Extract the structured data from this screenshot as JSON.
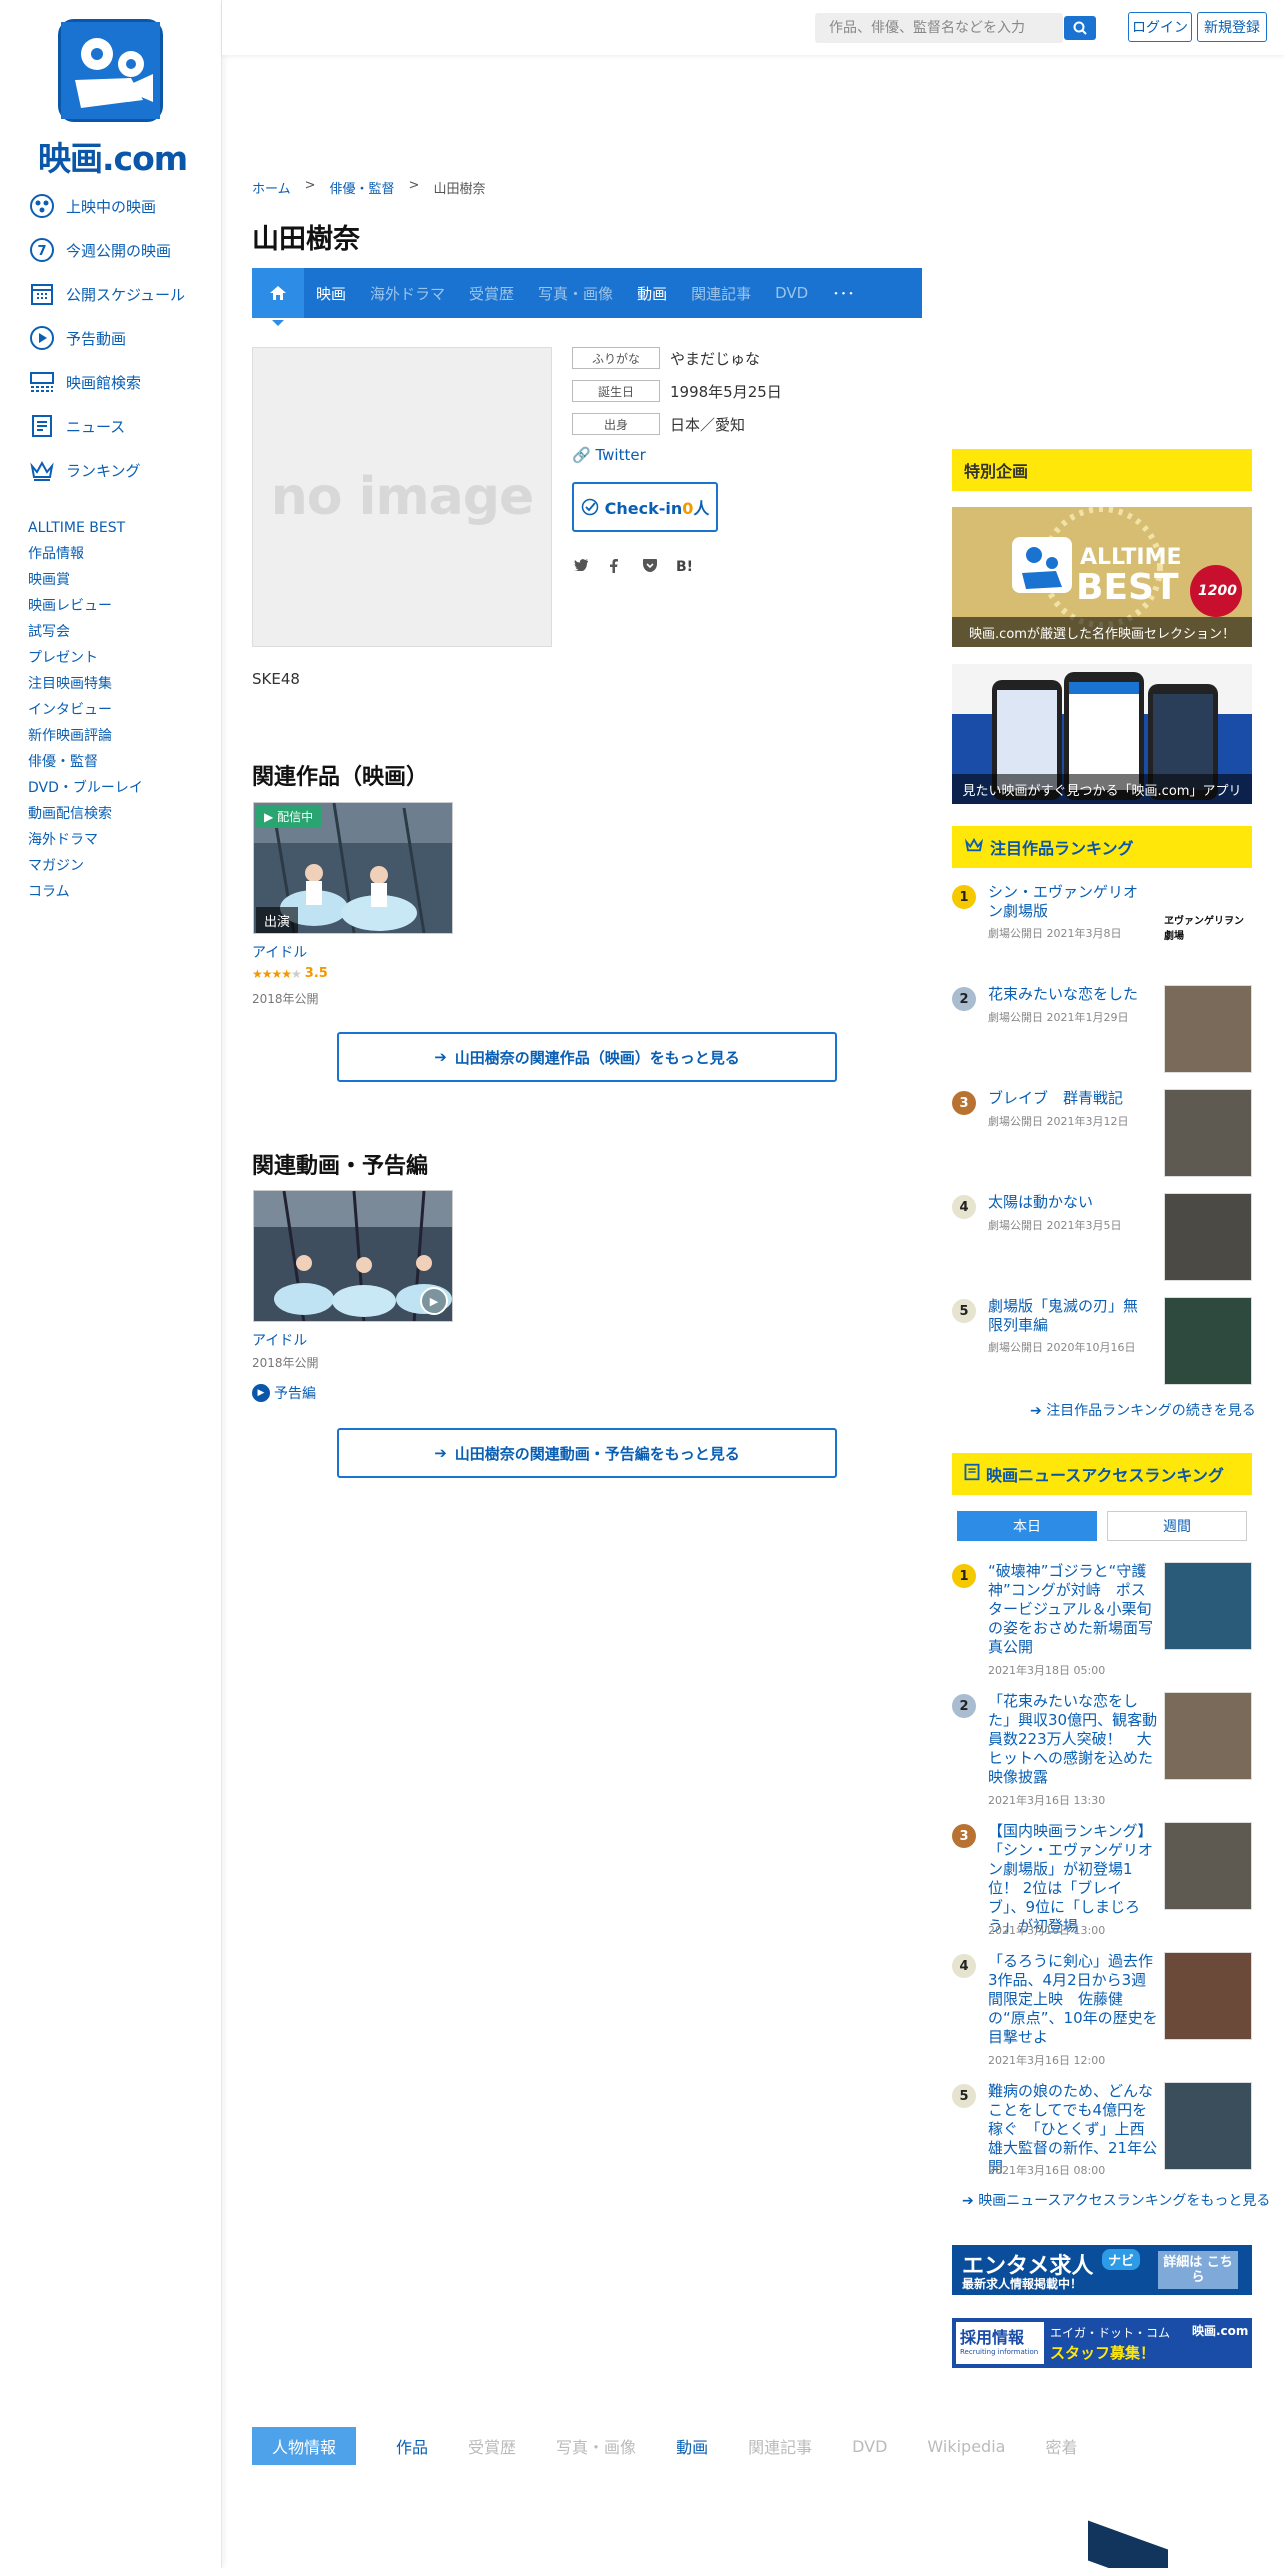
{
  "header": {
    "search_placeholder": "作品、俳優、監督名などを入力",
    "login": "ログイン",
    "register": "新規登録"
  },
  "sidebar": {
    "logo": "映画.com",
    "main_nav": [
      {
        "label": "上映中の映画",
        "icon": "film-reel-icon"
      },
      {
        "label": "今週公開の映画",
        "icon": "seven-icon"
      },
      {
        "label": "公開スケジュール",
        "icon": "calendar-icon"
      },
      {
        "label": "予告動画",
        "icon": "play-icon"
      },
      {
        "label": "映画館検索",
        "icon": "theater-icon"
      },
      {
        "label": "ニュース",
        "icon": "news-icon"
      },
      {
        "label": "ランキング",
        "icon": "crown-icon"
      }
    ],
    "sub_nav": [
      "ALLTIME BEST",
      "作品情報",
      "映画賞",
      "映画レビュー",
      "試写会",
      "プレゼント",
      "注目映画特集",
      "インタビュー",
      "新作映画評論",
      "俳優・監督",
      "DVD・ブルーレイ",
      "動画配信検索",
      "海外ドラマ",
      "マガジン",
      "コラム"
    ]
  },
  "breadcrumb": [
    "ホーム",
    "俳優・監督",
    "山田樹奈"
  ],
  "person": {
    "name": "山田樹奈",
    "furigana_label": "ふりがな",
    "furigana": "やまだじゅな",
    "birthday_label": "誕生日",
    "birthday": "1998年5月25日",
    "birthplace_label": "出身",
    "birthplace": "日本／愛知",
    "twitter": "Twitter",
    "checkin_prefix": "Check-in",
    "checkin_count": "0",
    "checkin_suffix": "人",
    "noimage": "no image",
    "group": "SKE48"
  },
  "tabs": [
    "映画",
    "海外ドラマ",
    "受賞歴",
    "写真・画像",
    "動画",
    "関連記事",
    "DVD",
    "･･･"
  ],
  "share": [
    "Twitter",
    "Facebook",
    "Pocket",
    "B!"
  ],
  "related_movies": {
    "title": "関連作品（映画）",
    "badge_streaming": "配信中",
    "badge_role": "出演",
    "movie_title": "アイドル",
    "rating": "3.5",
    "year": "2018年公開",
    "more": "山田樹奈の関連作品（映画）をもっと見る"
  },
  "related_videos": {
    "title": "関連動画・予告編",
    "movie_title": "アイドル",
    "year": "2018年公開",
    "trailer": "予告編",
    "more": "山田樹奈の関連動画・予告編をもっと見る"
  },
  "bottom_tabs": [
    "人物情報",
    "作品",
    "受賞歴",
    "写真・画像",
    "動画",
    "関連記事",
    "DVD",
    "Wikipedia",
    "密着"
  ],
  "right": {
    "special_title": "特別企画",
    "alltime_caption": "映画.comが厳選した名作映画セレクション！",
    "alltime_label_1": "ALLTIME",
    "alltime_label_2": "BEST",
    "alltime_count": "1200",
    "app_caption": "見たい映画がすぐ見つかる「映画.com」アプリ",
    "ranking_title": "注目作品ランキング",
    "ranking": [
      {
        "rank": "1",
        "title": "シン・エヴァンゲリオン劇場版",
        "date": "劇場公開日 2021年3月8日",
        "color": "#f5c800"
      },
      {
        "rank": "2",
        "title": "花束みたいな恋をした",
        "date": "劇場公開日 2021年1月29日",
        "color": "#a9bcd0"
      },
      {
        "rank": "3",
        "title": "ブレイブ　群青戦記",
        "date": "劇場公開日 2021年3月12日",
        "color": "#b87333"
      },
      {
        "rank": "4",
        "title": "太陽は動かない",
        "date": "劇場公開日 2021年3月5日",
        "color": "#e6e3cf"
      },
      {
        "rank": "5",
        "title": "劇場版「鬼滅の刃」無限列車編",
        "date": "劇場公開日 2020年10月16日",
        "color": "#e6e3cf"
      }
    ],
    "ranking_more": "注目作品ランキングの続きを見る",
    "evangelion_logo": "ヱヴァンゲリヲン劇場",
    "news_title": "映画ニュースアクセスランキング",
    "news_tab_day": "本日",
    "news_tab_week": "週間",
    "news": [
      {
        "rank": "1",
        "title": "“破壊神”ゴジラと“守護神”コングが対峙　ポスタービジュアル＆小栗旬の姿をおさめた新場面写真公開",
        "date": "2021年3月18日 05:00",
        "color": "#f5c800"
      },
      {
        "rank": "2",
        "title": "「花束みたいな恋をした」興収30億円、観客動員数223万人突破！　大ヒットへの感謝を込めた映像披露",
        "date": "2021年3月16日 13:30",
        "color": "#a9bcd0"
      },
      {
        "rank": "3",
        "title": "【国内映画ランキング】「シン・エヴァンゲリオン劇場版」が初登場1位！ 2位は「ブレイブ」、9位に「しまじろう」が初登場",
        "date": "2021年3月16日 13:00",
        "color": "#b87333"
      },
      {
        "rank": "4",
        "title": "「るろうに剣心」過去作3作品、4月2日から3週間限定上映　佐藤健の“原点”、10年の歴史を目撃せよ",
        "date": "2021年3月16日 12:00",
        "color": "#e6e3cf"
      },
      {
        "rank": "5",
        "title": "難病の娘のため、どんなことをしてでも4億円を稼ぐ　「ひとくず」上西雄大監督の新作、21年公開",
        "date": "2021年3月16日 08:00",
        "color": "#e6e3cf"
      }
    ],
    "news_more": "映画ニュースアクセスランキングをもっと見る",
    "job_banner_1": "エンタメ求人",
    "job_banner_1_sub": "最新求人情報掲載中！",
    "job_banner_1_badge": "ナビ",
    "job_banner_1_btn": "詳細は こちら",
    "job_banner_2_left": "採用情報",
    "job_banner_2_left_sub": "Recruiting information",
    "job_banner_2_mid": "エイガ・ドット・コム",
    "job_banner_2_mid_sub": "スタッフ募集！",
    "job_banner_2_logo": "映画.com"
  },
  "colors": {
    "brand": "#1a73d0",
    "yellow": "#ffe70a",
    "navy": "#0a56a8"
  }
}
